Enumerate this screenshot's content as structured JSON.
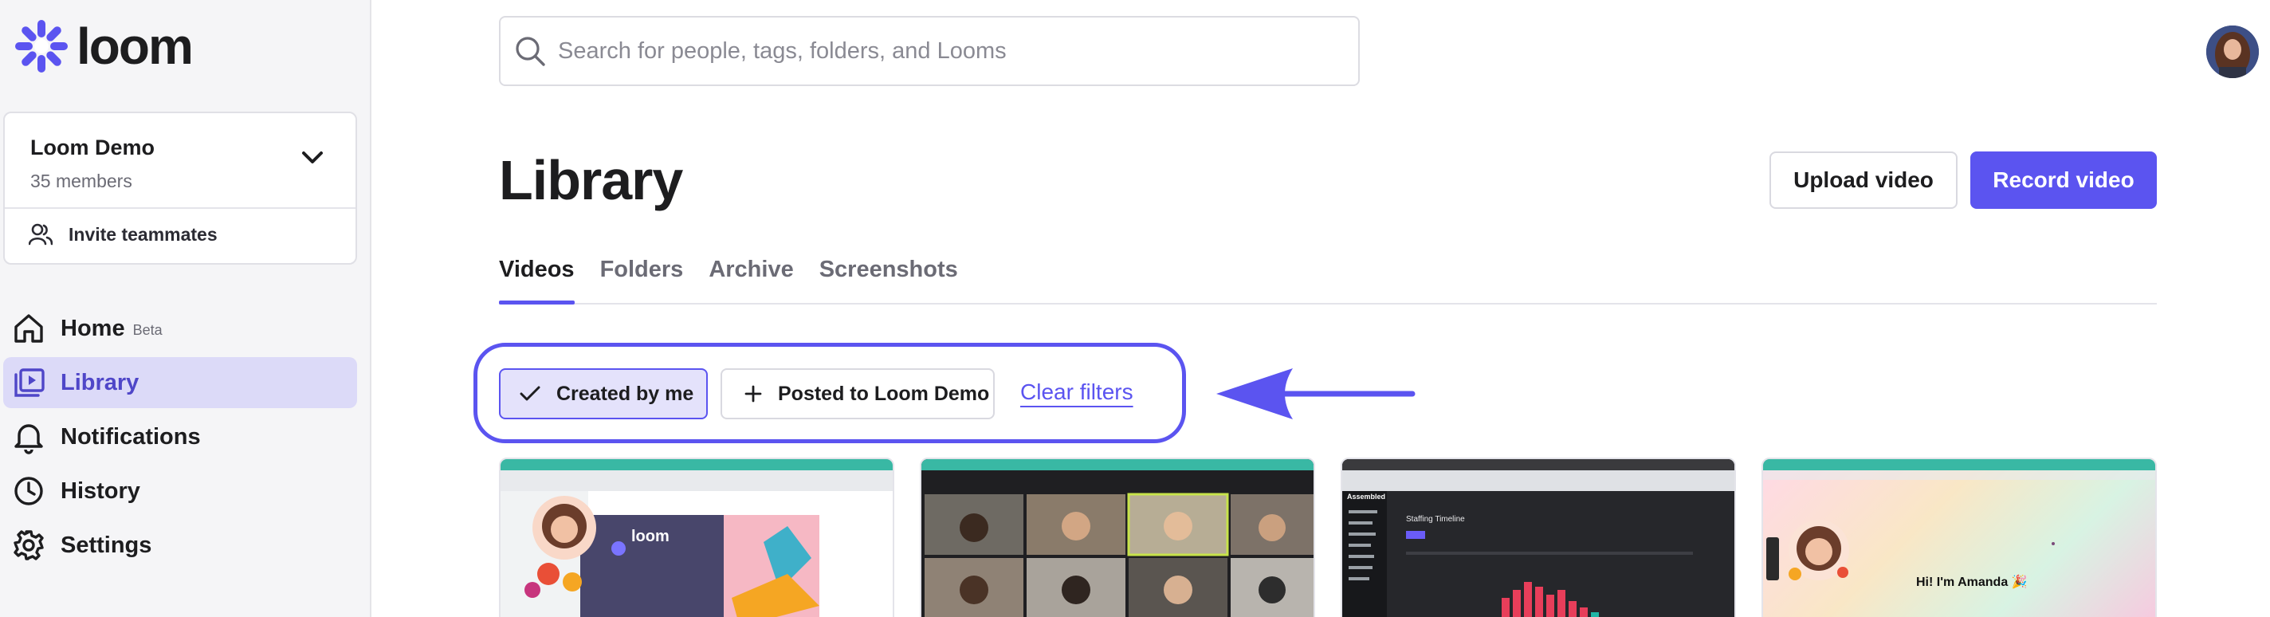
{
  "brand": {
    "name": "loom",
    "accent": "#5b54f0"
  },
  "sidebar": {
    "workspace": {
      "name": "Loom Demo",
      "members": "35 members"
    },
    "invite_label": "Invite teammates",
    "nav": [
      {
        "label": "Home",
        "badge": "Beta",
        "icon": "home-icon"
      },
      {
        "label": "Library",
        "icon": "library-icon",
        "active": true
      },
      {
        "label": "Notifications",
        "icon": "bell-icon"
      },
      {
        "label": "History",
        "icon": "clock-icon"
      },
      {
        "label": "Settings",
        "icon": "gear-icon"
      }
    ]
  },
  "search": {
    "placeholder": "Search for people, tags, folders, and Looms"
  },
  "main": {
    "title": "Library",
    "upload_label": "Upload video",
    "record_label": "Record video",
    "tabs": [
      {
        "label": "Videos",
        "active": true
      },
      {
        "label": "Folders"
      },
      {
        "label": "Archive"
      },
      {
        "label": "Screenshots"
      }
    ],
    "filters": {
      "created_by_me": "Created by me",
      "posted_to": "Posted to Loom Demo",
      "clear": "Clear filters"
    },
    "thumbnails": [
      {
        "logo_text": "loom"
      },
      {
        "caption": ""
      },
      {
        "heading": "Staffing Timeline",
        "brand": "Assembled"
      },
      {
        "greeting": "Hi! I'm Amanda 🎉"
      }
    ]
  }
}
